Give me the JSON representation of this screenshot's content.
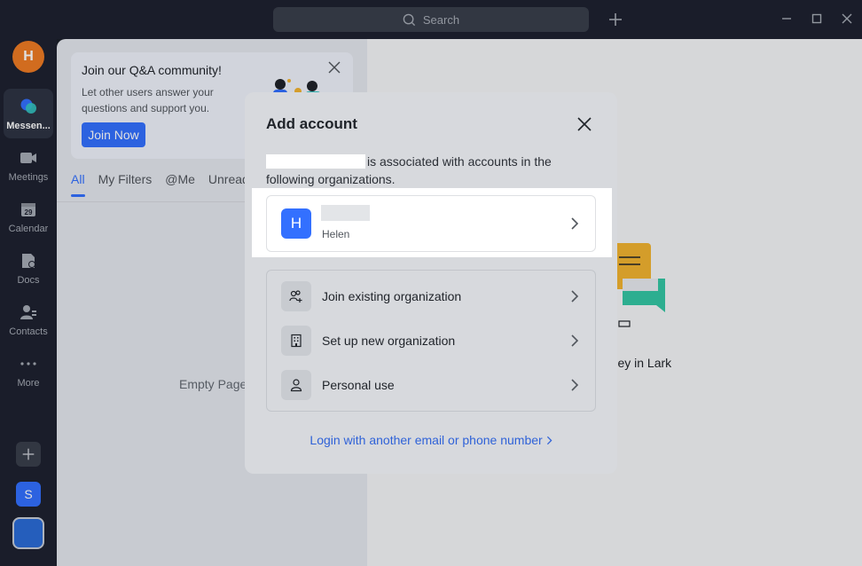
{
  "titlebar": {
    "search_placeholder": "Search",
    "icons": [
      "search-icon",
      "plus-icon",
      "minimize-icon",
      "maximize-icon",
      "close-icon"
    ]
  },
  "nav": {
    "avatar_initial": "H",
    "items": [
      {
        "label": "Messen...",
        "icon": "messenger-icon"
      },
      {
        "label": "Meetings",
        "icon": "video-camera-icon"
      },
      {
        "label": "Calendar",
        "icon": "calendar-icon",
        "badge": "29"
      },
      {
        "label": "Docs",
        "icon": "docs-icon"
      },
      {
        "label": "Contacts",
        "icon": "contacts-icon"
      },
      {
        "label": "More",
        "icon": "more-dots-icon"
      }
    ],
    "workspace_initial": "S"
  },
  "banner": {
    "title": "Join our Q&A community!",
    "body": "Let other users answer your questions and support you.",
    "button": "Join Now"
  },
  "tabs": [
    "All",
    "My Filters",
    "@Me",
    "Unread"
  ],
  "empty_text": "Empty Page",
  "journey_text": "rney in Lark",
  "modal": {
    "title": "Add account",
    "description_suffix": "is associated with accounts in the following organizations.",
    "org_card": {
      "initial": "H",
      "subtitle": "Helen"
    },
    "options": [
      {
        "label": "Join existing organization",
        "icon": "add-people-icon"
      },
      {
        "label": "Set up new organization",
        "icon": "building-icon"
      },
      {
        "label": "Personal use",
        "icon": "person-icon"
      }
    ],
    "login_link": "Login with another email or phone number"
  },
  "colors": {
    "accent": "#3370ff",
    "avatar_orange": "#ee7b24",
    "nav_bg": "#1e2230",
    "workspace_blue": "#2b6bd6"
  }
}
